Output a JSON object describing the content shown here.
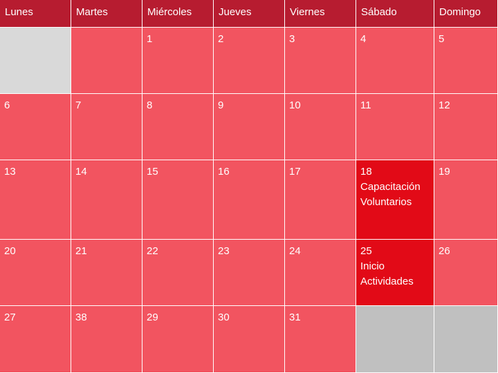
{
  "weekdays": [
    "Lunes",
    "Martes",
    "Miércoles",
    "Jueves",
    "Viernes",
    "Sábado",
    "Domingo"
  ],
  "weeks": [
    [
      null,
      "",
      "1",
      "2",
      "3",
      "4",
      "5"
    ],
    [
      "6",
      "7",
      "8",
      "9",
      "10",
      "11",
      "12"
    ],
    [
      "13",
      "14",
      "15",
      "16",
      "17",
      "18",
      "19"
    ],
    [
      "20",
      "21",
      "22",
      "23",
      "24",
      "25",
      "26"
    ],
    [
      "27",
      "38",
      "29",
      "30",
      "31",
      null,
      null
    ]
  ],
  "events": {
    "day18": [
      "Capacitación",
      "Voluntarios"
    ],
    "day25": [
      "Inicio",
      "Actividades"
    ]
  },
  "colors": {
    "header": "#b71c30",
    "day": "#f25460",
    "event": "#e20a17",
    "blank_light": "#d9d9d9",
    "blank_grey": "#c0c0c0",
    "text": "#ffffff"
  }
}
